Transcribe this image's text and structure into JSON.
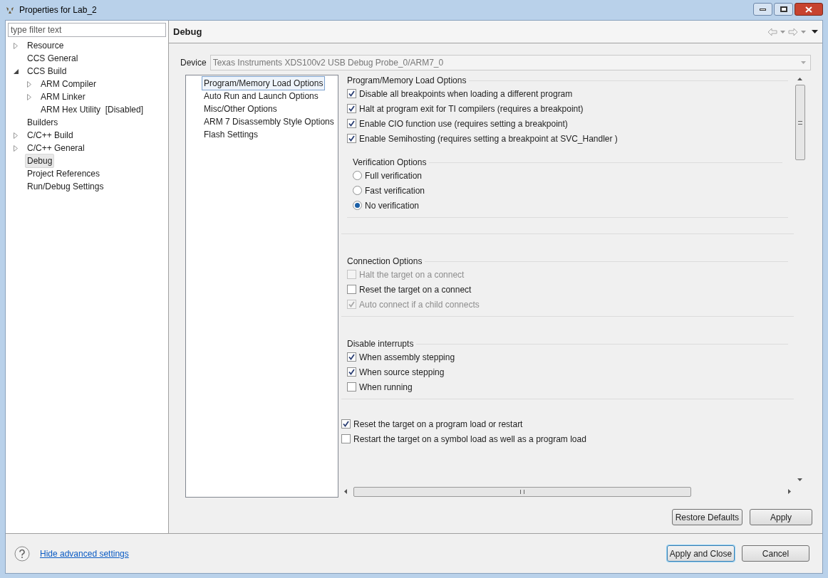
{
  "window": {
    "title": "Properties for Lab_2"
  },
  "filter": {
    "placeholder": "type filter text"
  },
  "tree": [
    {
      "label": "Resource",
      "expanded": false,
      "selected": false
    },
    {
      "label": "CCS General",
      "selected": false
    },
    {
      "label": "CCS Build",
      "expanded": true,
      "selected": false,
      "children": [
        {
          "label": "ARM Compiler",
          "expanded": false,
          "selected": false
        },
        {
          "label": "ARM Linker",
          "expanded": false,
          "selected": false
        },
        {
          "label": "ARM Hex Utility  [Disabled]",
          "selected": false
        }
      ]
    },
    {
      "label": "Builders",
      "selected": false
    },
    {
      "label": "C/C++ Build",
      "expanded": false,
      "selected": false
    },
    {
      "label": "C/C++ General",
      "expanded": false,
      "selected": false
    },
    {
      "label": "Debug",
      "selected": true
    },
    {
      "label": "Project References",
      "selected": false
    },
    {
      "label": "Run/Debug Settings",
      "selected": false
    }
  ],
  "page": {
    "title": "Debug",
    "device_label": "Device",
    "device_value": "Texas Instruments XDS100v2 USB Debug Probe_0/ARM7_0"
  },
  "categories": [
    {
      "label": "Program/Memory Load Options",
      "selected": true
    },
    {
      "label": "Auto Run and Launch Options",
      "selected": false
    },
    {
      "label": "Misc/Other Options",
      "selected": false
    },
    {
      "label": "ARM 7 Disassembly Style Options",
      "selected": false
    },
    {
      "label": "Flash Settings",
      "selected": false
    }
  ],
  "load_options": {
    "title": "Program/Memory Load Options",
    "options": [
      {
        "label": "Disable all breakpoints when loading a different program",
        "checked": true,
        "disabled": false
      },
      {
        "label": "Halt at program exit for TI compilers (requires a breakpoint)",
        "checked": true,
        "disabled": false
      },
      {
        "label": "Enable CIO function use (requires setting a breakpoint)",
        "checked": true,
        "disabled": false
      },
      {
        "label": "Enable Semihosting (requires setting a breakpoint at SVC_Handler )",
        "checked": true,
        "disabled": false
      }
    ],
    "verification": {
      "title": "Verification Options",
      "options": [
        {
          "label": "Full verification",
          "selected": false
        },
        {
          "label": "Fast verification",
          "selected": false
        },
        {
          "label": "No verification",
          "selected": true
        }
      ]
    }
  },
  "connection": {
    "title": "Connection Options",
    "options": [
      {
        "label": "Halt the target on a connect",
        "checked": false,
        "disabled": true
      },
      {
        "label": "Reset the target on a connect",
        "checked": false,
        "disabled": false
      },
      {
        "label": "Auto connect if a child connects",
        "checked": true,
        "disabled": true
      }
    ]
  },
  "interrupts": {
    "title": "Disable interrupts",
    "options": [
      {
        "label": "When assembly stepping",
        "checked": true,
        "disabled": false
      },
      {
        "label": "When source stepping",
        "checked": true,
        "disabled": false
      },
      {
        "label": "When running",
        "checked": false,
        "disabled": false
      }
    ]
  },
  "extra_options": [
    {
      "label": "Reset the target on a program load or restart",
      "checked": true,
      "disabled": false
    },
    {
      "label": "Restart the target on a symbol load as well as a program load",
      "checked": false,
      "disabled": false
    }
  ],
  "page_buttons": [
    "Restore Defaults",
    "Apply"
  ],
  "footer": {
    "link": "Hide advanced settings",
    "buttons": [
      {
        "label": "Apply and Close",
        "default": true
      },
      {
        "label": "Cancel",
        "default": false
      }
    ]
  }
}
